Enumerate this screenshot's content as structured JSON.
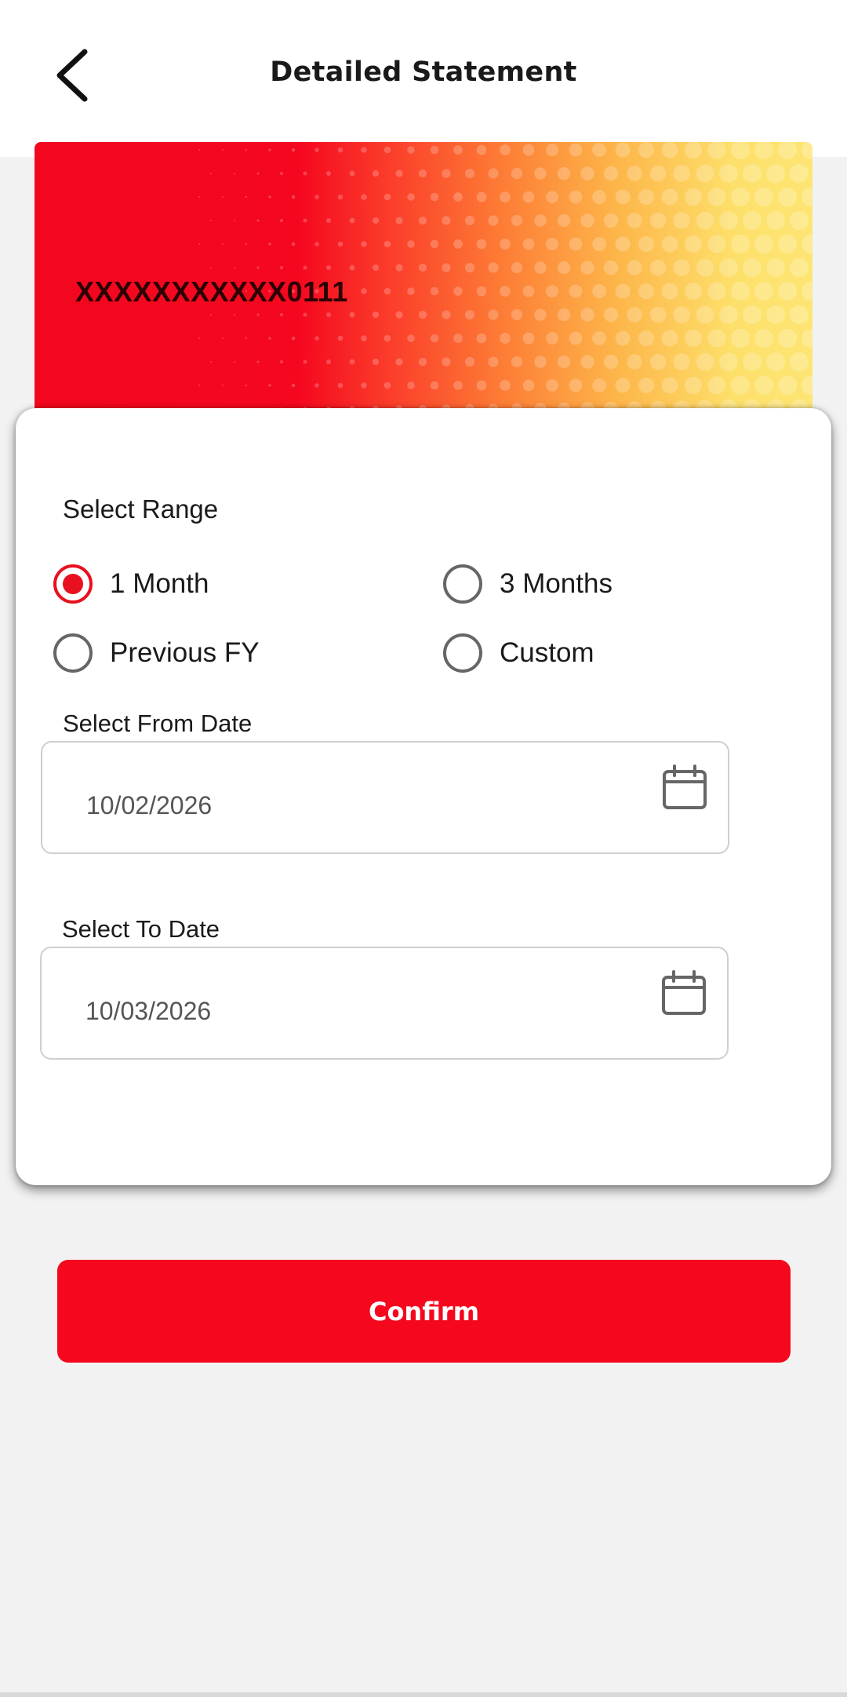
{
  "header": {
    "title": "Detailed Statement",
    "back_icon": "back-arrow-icon"
  },
  "account_card": {
    "account_number": "XXXXXXXXXXX0111",
    "gradient_colors": [
      "#f2071f",
      "#fd7c35",
      "#fde574"
    ]
  },
  "range": {
    "label": "Select Range",
    "options": [
      {
        "label": "1 Month",
        "selected": true
      },
      {
        "label": "3 Months",
        "selected": false
      },
      {
        "label": "Previous FY",
        "selected": false
      },
      {
        "label": "Custom",
        "selected": false
      }
    ]
  },
  "from_date": {
    "label": "Select From Date",
    "value": "10/02/2026",
    "icon": "calendar-icon"
  },
  "to_date": {
    "label": "Select To Date",
    "value": "10/03/2026",
    "icon": "calendar-icon"
  },
  "actions": {
    "confirm_label": "Confirm"
  },
  "colors": {
    "accent": "#f5071e",
    "radio_selected": "#e8101f",
    "background": "#f2f2f2"
  }
}
